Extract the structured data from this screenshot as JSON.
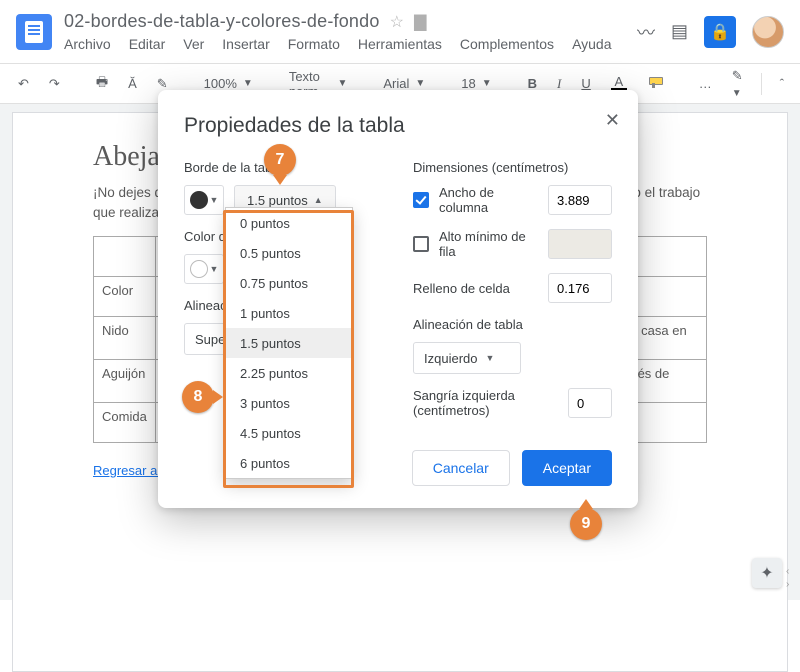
{
  "doc": {
    "title": "02-bordes-de-tabla-y-colores-de-fondo",
    "heading": "Abejas",
    "intro": "¡No dejes que estos zumbidos te engañen! Las abejas pueden tener un fuerte aguijón, pero el trabajo que realizan ayudando a polinizar las flores y los cultivos nos alimentan a todos.",
    "back_link": "Regresar al inicio"
  },
  "menus": {
    "archivo": "Archivo",
    "editar": "Editar",
    "ver": "Ver",
    "insertar": "Insertar",
    "formato": "Formato",
    "herramientas": "Herramientas",
    "complementos": "Complementos",
    "ayuda": "Ayuda"
  },
  "toolbar": {
    "zoom": "100%",
    "style": "Texto norm…",
    "font": "Arial",
    "size": "18",
    "more": "…"
  },
  "table": {
    "rows": [
      [
        "",
        "",
        " "
      ],
      [
        "Color",
        "",
        ""
      ],
      [
        "Nido",
        "",
        "Las abejas obreras vuelan lejos del panal en busca de flores y llevan el polen a casa en las bolsas de sus piernas."
      ],
      [
        "Aguijón",
        "",
        "El aguijón de una abeja está conectado a sus entrañas. Algunas mueren después de picar, pero otras pican muchas veces sin morir."
      ],
      [
        "Comida",
        "",
        ""
      ]
    ]
  },
  "dialog": {
    "title": "Propiedades de la tabla",
    "border_label": "Borde de la tabla",
    "border_width": "1.5 puntos",
    "bg_label": "Color de fondo de la celda",
    "valign_label": "Alineación vertical de celda",
    "valign_value": "Superior",
    "dims_label": "Dimensiones  (centímetros)",
    "col_width_label": "Ancho de columna",
    "col_width_value": "3.889",
    "row_height_label": "Alto mínimo de fila",
    "row_height_value": "",
    "padding_label": "Relleno de celda",
    "padding_value": "0.176",
    "talign_label": "Alineación de tabla",
    "talign_value": "Izquierdo",
    "indent_label": "Sangría izquierda  (centímetros)",
    "indent_value": "0",
    "cancel": "Cancelar",
    "accept": "Aceptar"
  },
  "dropdown": {
    "options": [
      "0 puntos",
      "0.5 puntos",
      "0.75 puntos",
      "1 puntos",
      "1.5 puntos",
      "2.25 puntos",
      "3 puntos",
      "4.5 puntos",
      "6 puntos"
    ],
    "selected": "1.5 puntos"
  },
  "callouts": {
    "c7": "7",
    "c8": "8",
    "c9": "9"
  }
}
